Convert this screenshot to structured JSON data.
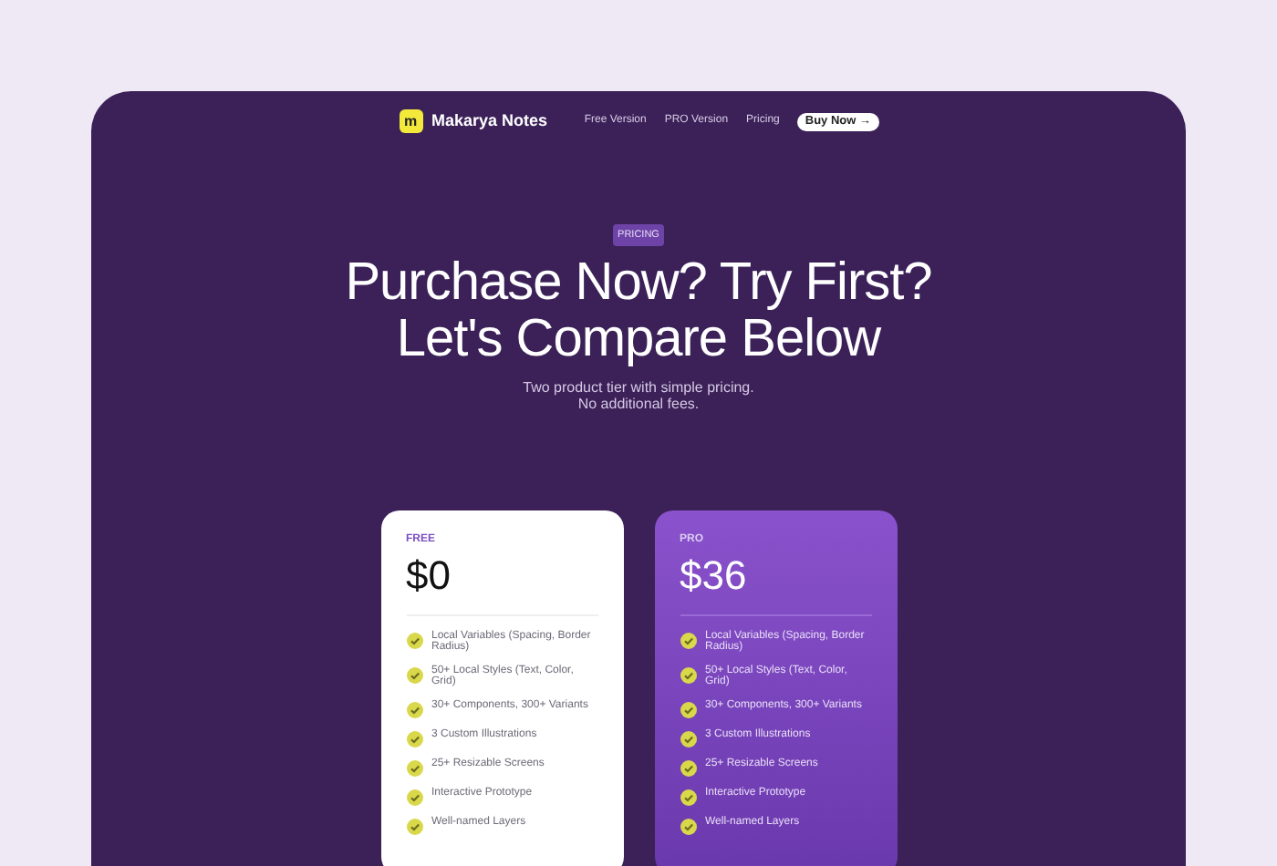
{
  "nav": {
    "logo_letter": "m",
    "brand": "Makarya Notes",
    "links": [
      "Free Version",
      "PRO Version",
      "Pricing"
    ],
    "cta": "Buy Now →"
  },
  "hero": {
    "badge": "PRICING",
    "title_lines": [
      "Purchase Now? Try First?",
      "Let's Compare Below"
    ],
    "subtitle_lines": [
      "Two product tier with simple pricing.",
      "No additional fees."
    ]
  },
  "plans": [
    {
      "kind": "free",
      "name": "FREE",
      "price": "$0",
      "features": [
        "Local Variables (Spacing, Border Radius)",
        "50+ Local Styles (Text, Color, Grid)",
        "30+ Components, 300+ Variants",
        "3 Custom Illustrations",
        "25+ Resizable Screens",
        "Interactive Prototype",
        "Well-named Layers"
      ]
    },
    {
      "kind": "pro",
      "name": "PRO",
      "price": "$36",
      "features": [
        "Local Variables (Spacing, Border Radius)",
        "50+ Local Styles (Text, Color, Grid)",
        "30+ Components, 300+ Variants",
        "3 Custom Illustrations",
        "25+ Resizable Screens",
        "Interactive Prototype",
        "Well-named Layers"
      ]
    }
  ]
}
